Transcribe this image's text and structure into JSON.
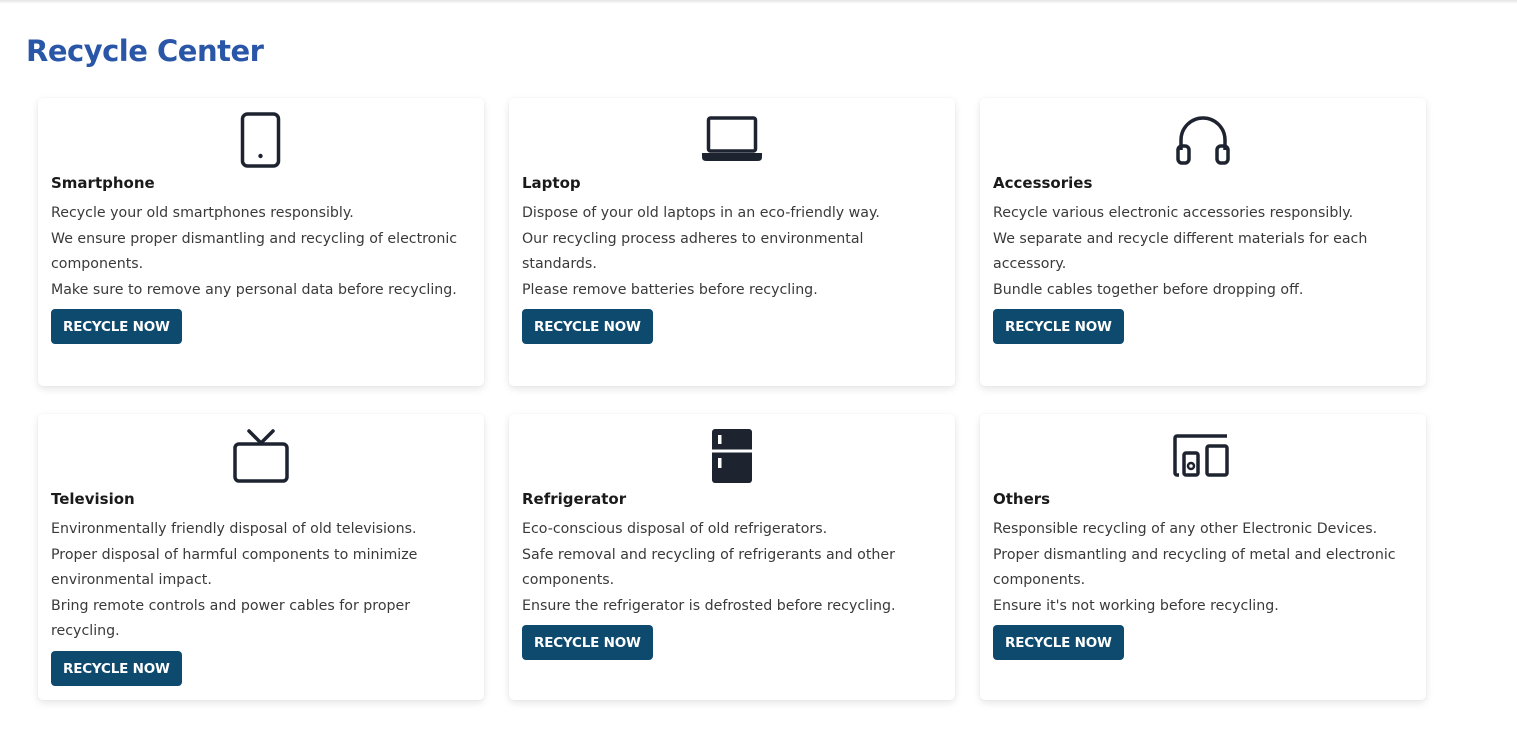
{
  "page": {
    "title": "Recycle Center"
  },
  "colors": {
    "title": "#2a56a8",
    "button_bg": "#0e4a6e",
    "button_text": "#ffffff",
    "icon": "#1e2330"
  },
  "cards": [
    {
      "icon": "smartphone-icon",
      "title": "Smartphone",
      "lines": [
        "Recycle your old smartphones responsibly.",
        "We ensure proper dismantling and recycling of electronic components.",
        "Make sure to remove any personal data before recycling."
      ],
      "button": "RECYCLE NOW"
    },
    {
      "icon": "laptop-icon",
      "title": "Laptop",
      "lines": [
        "Dispose of your old laptops in an eco-friendly way.",
        "Our recycling process adheres to environmental standards.",
        "Please remove batteries before recycling."
      ],
      "button": "RECYCLE NOW"
    },
    {
      "icon": "headphones-icon",
      "title": "Accessories",
      "lines": [
        "Recycle various electronic accessories responsibly.",
        "We separate and recycle different materials for each accessory.",
        "Bundle cables together before dropping off."
      ],
      "button": "RECYCLE NOW"
    },
    {
      "icon": "television-icon",
      "title": "Television",
      "lines": [
        "Environmentally friendly disposal of old televisions.",
        "Proper disposal of harmful components to minimize environmental impact.",
        "Bring remote controls and power cables for proper recycling."
      ],
      "button": "RECYCLE NOW"
    },
    {
      "icon": "refrigerator-icon",
      "title": "Refrigerator",
      "lines": [
        "Eco-conscious disposal of old refrigerators.",
        "Safe removal and recycling of refrigerants and other components.",
        "Ensure the refrigerator is defrosted before recycling."
      ],
      "button": "RECYCLE NOW"
    },
    {
      "icon": "devices-icon",
      "title": "Others",
      "lines": [
        "Responsible recycling of any other Electronic Devices.",
        "Proper dismantling and recycling of metal and electronic components.",
        "Ensure it's not working before recycling."
      ],
      "button": "RECYCLE NOW"
    }
  ]
}
